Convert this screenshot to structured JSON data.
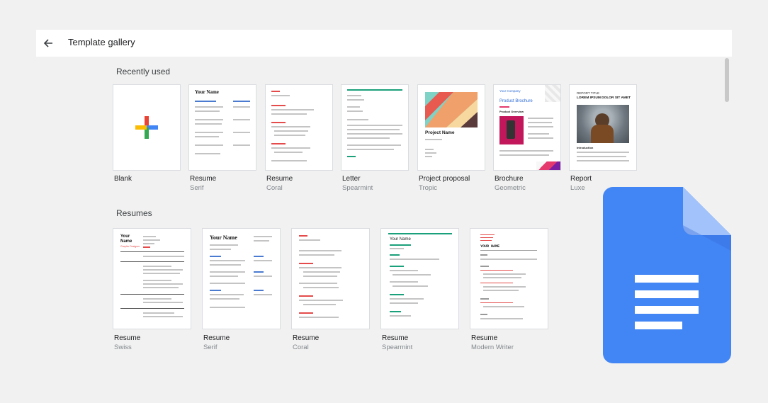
{
  "header": {
    "title": "Template gallery"
  },
  "sections": {
    "recent": {
      "title": "Recently used",
      "items": [
        {
          "label": "Blank",
          "sub": ""
        },
        {
          "label": "Resume",
          "sub": "Serif"
        },
        {
          "label": "Resume",
          "sub": "Coral"
        },
        {
          "label": "Letter",
          "sub": "Spearmint"
        },
        {
          "label": "Project proposal",
          "sub": "Tropic"
        },
        {
          "label": "Brochure",
          "sub": "Geometric"
        },
        {
          "label": "Report",
          "sub": "Luxe"
        }
      ]
    },
    "resumes": {
      "title": "Resumes",
      "items": [
        {
          "label": "Resume",
          "sub": "Swiss"
        },
        {
          "label": "Resume",
          "sub": "Serif"
        },
        {
          "label": "Resume",
          "sub": "Coral"
        },
        {
          "label": "Resume",
          "sub": "Spearmint"
        },
        {
          "label": "Resume",
          "sub": "Modern Writer"
        }
      ]
    }
  },
  "thumbs": {
    "serif_name": "Your Name",
    "project_name": "Project Name",
    "brochure_company": "Your Company",
    "brochure_title": "Product Brochure",
    "brochure_overview": "Product Overview",
    "report_title": "REPORT TITLE",
    "report_sub": "LOREM IPSUM DOLOR SIT AMET",
    "report_intro": "Introduction",
    "swiss_name": "Your Name",
    "swiss_sub": "Graphic Designer",
    "spearmint_name": "Your Name",
    "modern_name": "YOUR NAME"
  },
  "colors": {
    "docs_blue": "#4285f4",
    "coral": "#e54b4b",
    "spearmint": "#1aa07a",
    "brochure_accent": "#2d6bd6"
  },
  "icons": {
    "back": "arrow-left-icon",
    "blank": "plus-icon",
    "app": "google-docs-icon"
  }
}
